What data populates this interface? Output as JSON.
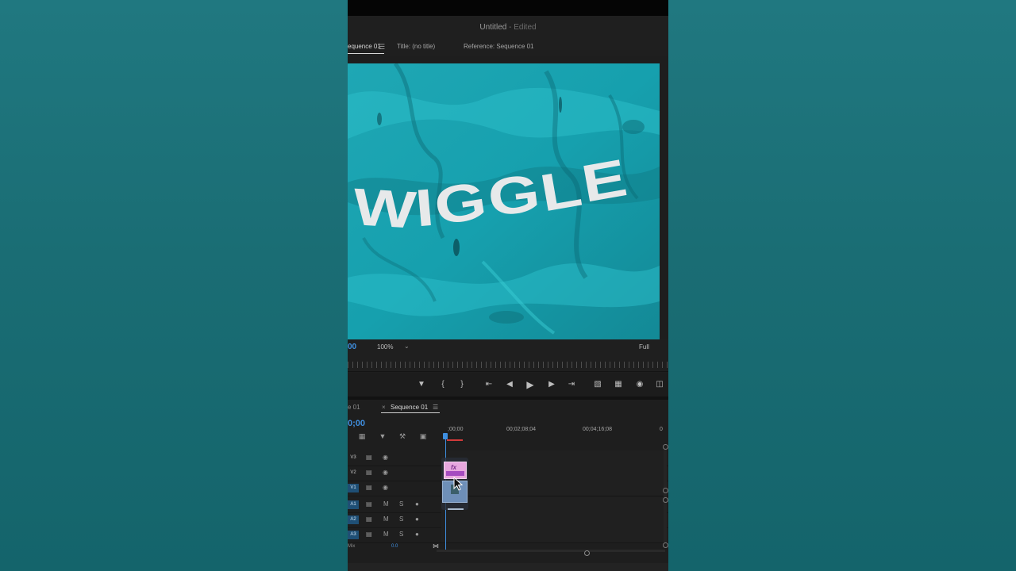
{
  "window": {
    "title": "Untitled",
    "title_suffix": " - Edited"
  },
  "monitor_tabs": [
    {
      "label": "equence 01",
      "active": true
    },
    {
      "label": "Title: (no title)",
      "active": false
    },
    {
      "label": "Reference: Sequence 01",
      "active": false
    }
  ],
  "program_monitor": {
    "frame_text": "WIGGLE",
    "timecode": "00",
    "zoom": "100%",
    "quality": "Full"
  },
  "timeline": {
    "tabs": [
      {
        "label": "e 01",
        "active": false
      },
      {
        "label": "Sequence 01",
        "active": true
      }
    ],
    "timecode": "0;00",
    "ruler_labels": [
      ";00;00",
      "00;02;08;04",
      "00;04;16;08",
      "0"
    ],
    "video_tracks": [
      {
        "label": "V3",
        "targeted": false
      },
      {
        "label": "V2",
        "targeted": false
      },
      {
        "label": "V1",
        "targeted": true
      }
    ],
    "audio_tracks": [
      {
        "label": "A1",
        "mute": "M",
        "solo": "S"
      },
      {
        "label": "A2",
        "mute": "M",
        "solo": "S"
      },
      {
        "label": "A3",
        "mute": "M",
        "solo": "S"
      }
    ],
    "mix_label": "Mix",
    "mix_value": "0.0",
    "clip_fx_badge": "fx"
  },
  "colors": {
    "accent_blue": "#3f8fe0",
    "graphic_clip": "#e7a7de",
    "video_clip": "#6e8fb8",
    "background_teal": "#1c6f75"
  }
}
